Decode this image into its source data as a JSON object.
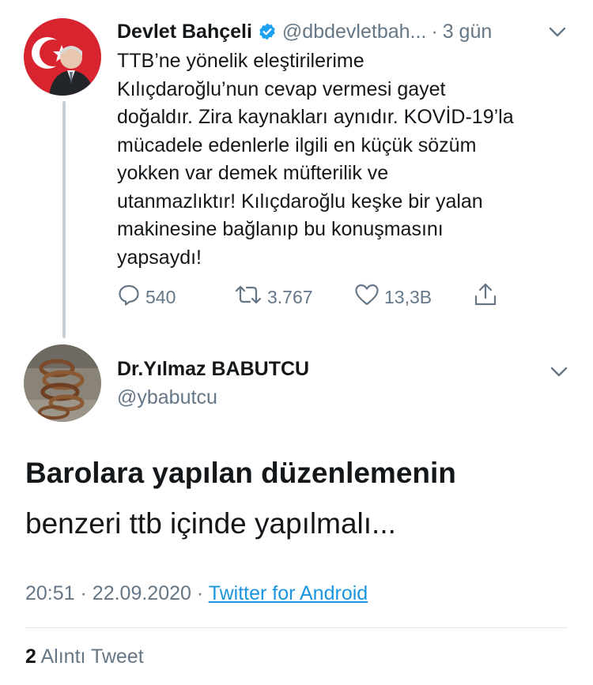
{
  "tweet1": {
    "name": "Devlet Bahçeli",
    "handle": "@dbdevletbah...",
    "separator": "·",
    "time": "3 gün",
    "text_lines": [
      "TTB’ne yönelik eleştirilerime",
      "Kılıçdaroğlu’nun cevap vermesi gayet",
      "doğaldır. Zira kaynakları aynıdır. KOVİD-19’la",
      "mücadele edenlerle ilgili en küçük sözüm",
      "yokken var demek müfterilik ve",
      "utanmazlıktır! Kılıçdaroğlu keşke bir yalan",
      "makinesine bağlanıp bu konuşmasını",
      "yapsaydı!"
    ],
    "replies": "540",
    "retweets": "3.767",
    "likes": "13,3B"
  },
  "tweet2": {
    "name": "Dr.Yılmaz BABUTCU",
    "handle": "@ybabutcu",
    "text_bold": "Barolara yapılan düzenlemenin",
    "text_normal": "benzeri ttb içinde yapılmalı...",
    "time": "20:51",
    "date": "22.09.2020",
    "sep": "·",
    "source": "Twitter for Android",
    "quote_count": "2",
    "quote_label": "Alıntı Tweet"
  },
  "colors": {
    "accent": "#1da1f2",
    "muted": "#657786",
    "text": "#14171a",
    "thread": "#c4cfd6",
    "link": "#1b95e0"
  },
  "icons": {
    "verified": "verified-badge-icon",
    "menu": "chevron-down-icon",
    "reply": "reply-icon",
    "retweet": "retweet-icon",
    "like": "heart-icon",
    "share": "share-icon"
  }
}
